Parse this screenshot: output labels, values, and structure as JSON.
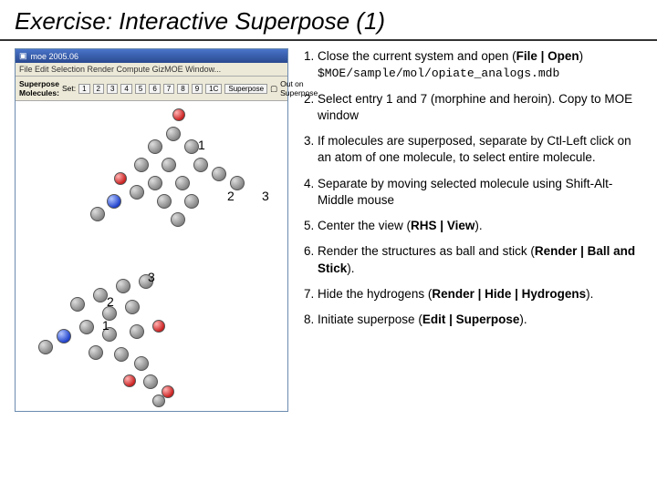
{
  "title": "Exercise: Interactive Superpose (1)",
  "app": {
    "window_title": "moe 2005.06",
    "menu": "File  Edit  Selection  Render  Compute  GizMOE  Window...",
    "toolbar_label": "Superpose Molecules:",
    "toolbar_set": "Set:",
    "toolbar_buttons": [
      "1",
      "2",
      "3",
      "4",
      "5",
      "6",
      "7",
      "8",
      "9",
      "1C"
    ],
    "toolbar_superpose": "Superpose",
    "toolbar_out": "Out on Superpose"
  },
  "mol_labels": {
    "top_1": "1",
    "top_2": "2",
    "top_3": "3",
    "bot_1": "1",
    "bot_2": "2",
    "bot_3": "3"
  },
  "steps": [
    {
      "prefix": "Close the current system and open (",
      "bold1": "File | Open",
      "mid": ") ",
      "mono": "$MOE/sample/mol/opiate_analogs.mdb",
      "suffix": ""
    },
    {
      "text": "Select entry 1 and 7 (morphine and heroin). Copy to MOE window"
    },
    {
      "text": "If molecules are superposed, separate by Ctl-Left click on an atom of one molecule, to select entire molecule."
    },
    {
      "text": "Separate by moving selected molecule using Shift-Alt-Middle mouse"
    },
    {
      "prefix": "Center the view (",
      "bold1": "RHS | View",
      "suffix": ")."
    },
    {
      "prefix": "Render the structures as ball and stick (",
      "bold1": "Render | Ball and Stick",
      "suffix": ")."
    },
    {
      "prefix": "Hide the hydrogens (",
      "bold1": "Render | Hide | Hydrogens",
      "suffix": ")."
    },
    {
      "prefix": "Initiate superpose (",
      "bold1": "Edit | Superpose",
      "suffix": ")."
    }
  ]
}
